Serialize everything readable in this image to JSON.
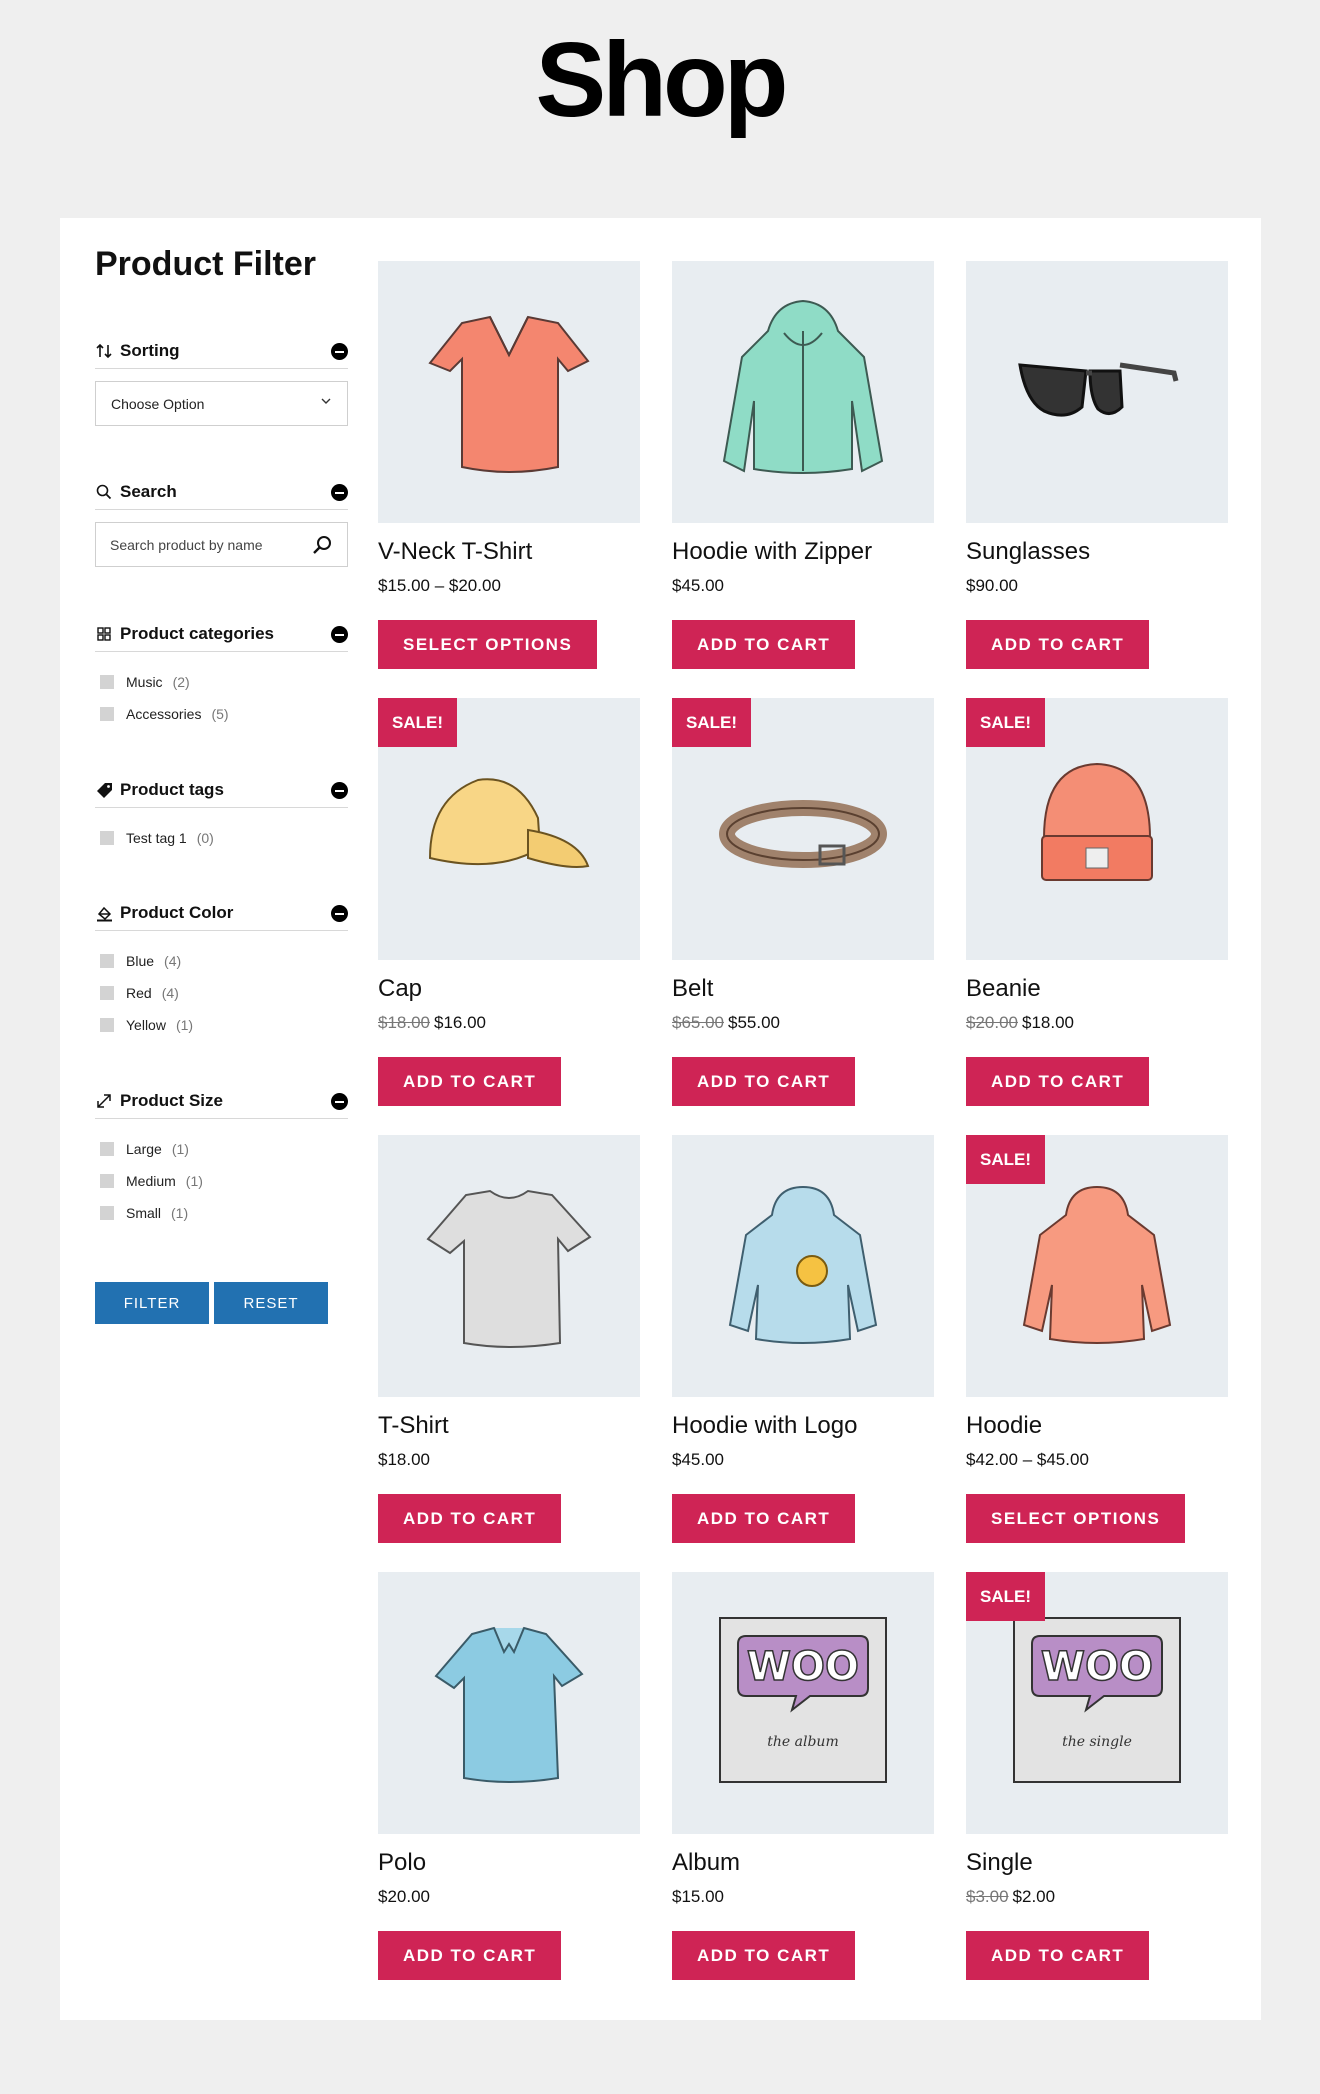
{
  "page": {
    "title": "Shop"
  },
  "sidebar": {
    "title": "Product Filter",
    "sorting": {
      "label": "Sorting",
      "selected": "Choose Option"
    },
    "search": {
      "label": "Search",
      "placeholder": "Search product by name"
    },
    "categories": {
      "label": "Product categories",
      "items": [
        {
          "name": "Music",
          "count": "(2)"
        },
        {
          "name": "Accessories",
          "count": "(5)"
        }
      ]
    },
    "tags": {
      "label": "Product tags",
      "items": [
        {
          "name": "Test tag 1",
          "count": "(0)"
        }
      ]
    },
    "color": {
      "label": "Product Color",
      "items": [
        {
          "name": "Blue",
          "count": "(4)"
        },
        {
          "name": "Red",
          "count": "(4)"
        },
        {
          "name": "Yellow",
          "count": "(1)"
        }
      ]
    },
    "size": {
      "label": "Product Size",
      "items": [
        {
          "name": "Large",
          "count": "(1)"
        },
        {
          "name": "Medium",
          "count": "(1)"
        },
        {
          "name": "Small",
          "count": "(1)"
        }
      ]
    },
    "filter_button": "FILTER",
    "reset_button": "RESET"
  },
  "products": [
    {
      "name": "V-Neck T-Shirt",
      "price": "$15.00 – $20.00",
      "old_price": "",
      "sale": "",
      "button": "SELECT OPTIONS",
      "image": "vneck-tshirt"
    },
    {
      "name": "Hoodie with Zipper",
      "price": "$45.00",
      "old_price": "",
      "sale": "",
      "button": "ADD TO CART",
      "image": "zip-hoodie"
    },
    {
      "name": "Sunglasses",
      "price": "$90.00",
      "old_price": "",
      "sale": "",
      "button": "ADD TO CART",
      "image": "sunglasses"
    },
    {
      "name": "Cap",
      "price": "$16.00",
      "old_price": "$18.00",
      "sale": "SALE!",
      "button": "ADD TO CART",
      "image": "cap"
    },
    {
      "name": "Belt",
      "price": "$55.00",
      "old_price": "$65.00",
      "sale": "SALE!",
      "button": "ADD TO CART",
      "image": "belt"
    },
    {
      "name": "Beanie",
      "price": "$18.00",
      "old_price": "$20.00",
      "sale": "SALE!",
      "button": "ADD TO CART",
      "image": "beanie"
    },
    {
      "name": "T-Shirt",
      "price": "$18.00",
      "old_price": "",
      "sale": "",
      "button": "ADD TO CART",
      "image": "tshirt"
    },
    {
      "name": "Hoodie with Logo",
      "price": "$45.00",
      "old_price": "",
      "sale": "",
      "button": "ADD TO CART",
      "image": "logo-hoodie"
    },
    {
      "name": "Hoodie",
      "price": "$42.00 – $45.00",
      "old_price": "",
      "sale": "SALE!",
      "button": "SELECT OPTIONS",
      "image": "hoodie"
    },
    {
      "name": "Polo",
      "price": "$20.00",
      "old_price": "",
      "sale": "",
      "button": "ADD TO CART",
      "image": "polo"
    },
    {
      "name": "Album",
      "price": "$15.00",
      "old_price": "",
      "sale": "",
      "button": "ADD TO CART",
      "image": "album",
      "art_text": "WOO",
      "caption": "the album"
    },
    {
      "name": "Single",
      "price": "$2.00",
      "old_price": "$3.00",
      "sale": "SALE!",
      "button": "ADD TO CART",
      "image": "single",
      "art_text": "WOO",
      "caption": "the single"
    }
  ],
  "colors": {
    "accent": "#cf2455",
    "filter_blue": "#2271b1",
    "thumb_bg": "#e8edf1"
  }
}
